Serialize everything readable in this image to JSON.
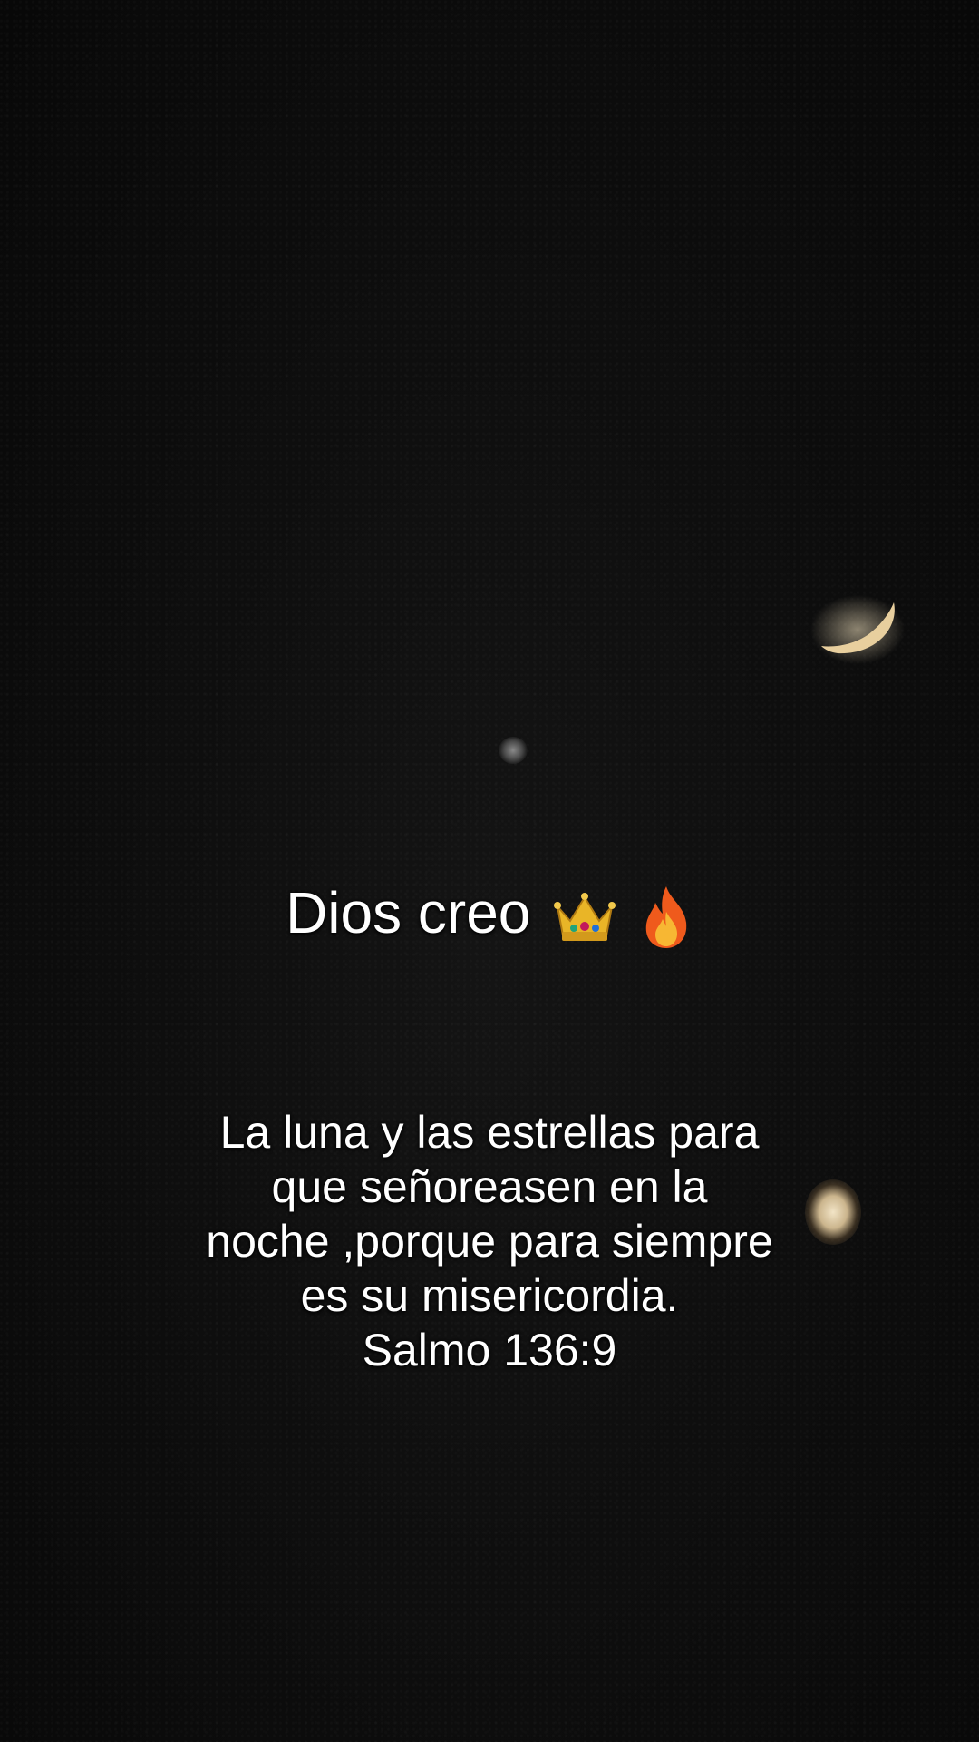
{
  "headline": {
    "text": "Dios creo",
    "emojis": [
      "crown-icon",
      "fire-icon"
    ]
  },
  "verse": {
    "lines": [
      "La luna y las estrellas para",
      "que señoreasen en la",
      "noche ,porque para siempre",
      "es su misericordia.",
      "Salmo 136:9"
    ]
  },
  "colors": {
    "background": "#0c0c0c",
    "text": "#ffffff",
    "moon": "#e8cf9e"
  }
}
